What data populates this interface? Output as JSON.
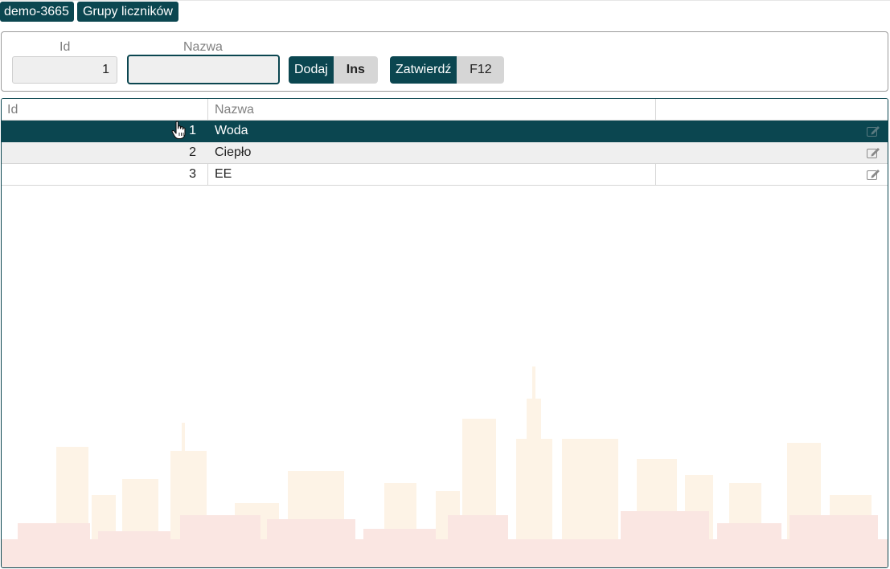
{
  "breadcrumb": [
    "demo-3665",
    "Grupy liczników"
  ],
  "form": {
    "id_label": "Id",
    "id_value": "1",
    "name_label": "Nazwa",
    "name_value": "",
    "add_label": "Dodaj",
    "add_key": "Ins",
    "confirm_label": "Zatwierdź",
    "confirm_key": "F12"
  },
  "table": {
    "columns": [
      "Id",
      "Nazwa",
      ""
    ],
    "rows": [
      {
        "id": "1",
        "name": "Woda"
      },
      {
        "id": "2",
        "name": "Ciepło"
      },
      {
        "id": "3",
        "name": "EE"
      }
    ],
    "selected_row": 0
  },
  "colors": {
    "accent": "#0b4650",
    "key_bg": "#d6d6d6",
    "alt_row": "#efefef"
  },
  "icons": [
    "edit-icon",
    "hand-cursor-icon"
  ]
}
